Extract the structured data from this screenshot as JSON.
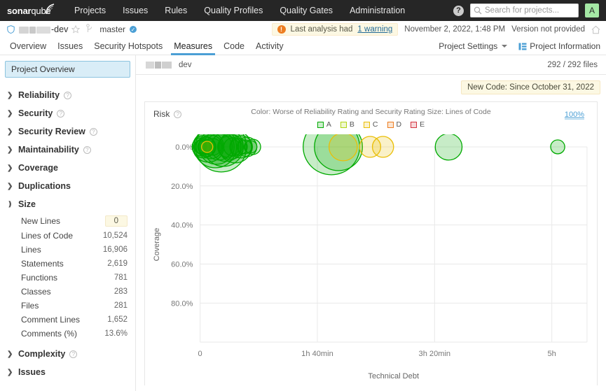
{
  "topnav": {
    "logo": {
      "bold": "sonar",
      "light": "qube",
      "icon": "sonarqube-logo"
    },
    "links": [
      {
        "label": "Projects",
        "name": "nav-projects"
      },
      {
        "label": "Issues",
        "name": "nav-issues"
      },
      {
        "label": "Rules",
        "name": "nav-rules"
      },
      {
        "label": "Quality Profiles",
        "name": "nav-quality-profiles"
      },
      {
        "label": "Quality Gates",
        "name": "nav-quality-gates"
      },
      {
        "label": "Administration",
        "name": "nav-administration"
      }
    ],
    "help_icon": "help-icon",
    "search": {
      "placeholder": "Search for projects...",
      "value": ""
    },
    "avatar_initial": "A",
    "avatar_color": "#a5e8a5",
    "background": "#262626"
  },
  "project_header": {
    "quality_gate_icon": "quality-gate-shield-icon",
    "project_name_suffix": "-dev",
    "project_name_redacted": true,
    "favorite_icon": "star-icon",
    "branch_icon": "branch-icon",
    "branch_name": "master",
    "branch_badge": "✓",
    "warning_prefix": "Last analysis had",
    "warning_link": "1 warning",
    "analysis_date": "November 2, 2022, 1:48 PM",
    "version": "Version not provided",
    "home_icon": "home-icon"
  },
  "tabs": {
    "items": [
      {
        "label": "Overview",
        "name": "tab-overview",
        "active": false
      },
      {
        "label": "Issues",
        "name": "tab-issues",
        "active": false
      },
      {
        "label": "Security Hotspots",
        "name": "tab-security-hotspots",
        "active": false
      },
      {
        "label": "Measures",
        "name": "tab-measures",
        "active": true
      },
      {
        "label": "Code",
        "name": "tab-code",
        "active": false
      },
      {
        "label": "Activity",
        "name": "tab-activity",
        "active": false
      }
    ],
    "project_settings": "Project Settings",
    "project_information": "Project Information",
    "active_color": "#4b9fd5"
  },
  "sidebar": {
    "overview_button": "Project Overview",
    "groups": [
      {
        "label": "Reliability",
        "name": "sidebar-group-reliability",
        "expanded": false,
        "help": true
      },
      {
        "label": "Security",
        "name": "sidebar-group-security",
        "expanded": false,
        "help": true
      },
      {
        "label": "Security Review",
        "name": "sidebar-group-security-review",
        "expanded": false,
        "help": true
      },
      {
        "label": "Maintainability",
        "name": "sidebar-group-maintainability",
        "expanded": false,
        "help": true
      },
      {
        "label": "Coverage",
        "name": "sidebar-group-coverage",
        "expanded": false,
        "help": false
      },
      {
        "label": "Duplications",
        "name": "sidebar-group-duplications",
        "expanded": false,
        "help": false
      },
      {
        "label": "Size",
        "name": "sidebar-group-size",
        "expanded": true,
        "help": false
      }
    ],
    "size_metrics": [
      {
        "label": "New Lines",
        "value": "0",
        "badge": true
      },
      {
        "label": "Lines of Code",
        "value": "10,524",
        "badge": false
      },
      {
        "label": "Lines",
        "value": "16,906",
        "badge": false
      },
      {
        "label": "Statements",
        "value": "2,619",
        "badge": false
      },
      {
        "label": "Functions",
        "value": "781",
        "badge": false
      },
      {
        "label": "Classes",
        "value": "283",
        "badge": false
      },
      {
        "label": "Files",
        "value": "281",
        "badge": false
      },
      {
        "label": "Comment Lines",
        "value": "1,652",
        "badge": false
      },
      {
        "label": "Comments (%)",
        "value": "13.6%",
        "badge": false
      }
    ],
    "bottom_groups": [
      {
        "label": "Complexity",
        "name": "sidebar-group-complexity",
        "help": true
      },
      {
        "label": "Issues",
        "name": "sidebar-group-issues",
        "help": false
      }
    ]
  },
  "main": {
    "breadcrumb_label": "dev",
    "breadcrumb_redacted": true,
    "files_count": "292 / 292 files",
    "new_code_badge": "New Code: Since October 31, 2022"
  },
  "chart_data": {
    "type": "scatter",
    "title": "Risk",
    "caption": "Color: Worse of Reliability Rating and Security Rating  Size: Lines of Code",
    "xlabel": "Technical Debt",
    "ylabel": "Coverage",
    "x_ticks": [
      "0",
      "1h 40min",
      "3h 20min",
      "5h"
    ],
    "x_tick_values": [
      0,
      100,
      200,
      300
    ],
    "xlim": [
      0,
      330
    ],
    "y_ticks": [
      "0.0%",
      "20.0%",
      "40.0%",
      "60.0%",
      "80.0%"
    ],
    "y_tick_values": [
      0,
      20,
      40,
      60,
      80
    ],
    "ylim": [
      0,
      100
    ],
    "y_inverted": true,
    "grid": true,
    "top_right_link": "100%",
    "legend_position": "top-center",
    "legend": [
      {
        "label": "A",
        "color": "#00aa00",
        "fill": "#00aa0033"
      },
      {
        "label": "B",
        "color": "#b0d513",
        "fill": "#b0d51333"
      },
      {
        "label": "C",
        "color": "#eabe06",
        "fill": "#eabe0633"
      },
      {
        "label": "D",
        "color": "#ed7d20",
        "fill": "#ed7d2033"
      },
      {
        "label": "E",
        "color": "#d4333f",
        "fill": "#d4333f33"
      }
    ],
    "bubbles": [
      {
        "x": 0,
        "y": 0,
        "r": 9,
        "rating": "A"
      },
      {
        "x": 1,
        "y": 0,
        "r": 13,
        "rating": "A"
      },
      {
        "x": 2,
        "y": 0,
        "r": 11,
        "rating": "A"
      },
      {
        "x": 3,
        "y": 0,
        "r": 16,
        "rating": "A"
      },
      {
        "x": 4,
        "y": 0,
        "r": 10,
        "rating": "A"
      },
      {
        "x": 5,
        "y": 0,
        "r": 14,
        "rating": "A"
      },
      {
        "x": 6,
        "y": 0,
        "r": 8,
        "rating": "C"
      },
      {
        "x": 7,
        "y": 0,
        "r": 22,
        "rating": "A"
      },
      {
        "x": 9,
        "y": 0,
        "r": 17,
        "rating": "A"
      },
      {
        "x": 11,
        "y": 0,
        "r": 12,
        "rating": "A"
      },
      {
        "x": 13,
        "y": 0,
        "r": 30,
        "rating": "A"
      },
      {
        "x": 14,
        "y": 0,
        "r": 25,
        "rating": "A"
      },
      {
        "x": 16,
        "y": 0,
        "r": 19,
        "rating": "A"
      },
      {
        "x": 18,
        "y": 0,
        "r": 36,
        "rating": "A"
      },
      {
        "x": 20,
        "y": 0,
        "r": 28,
        "rating": "A"
      },
      {
        "x": 22,
        "y": 0,
        "r": 21,
        "rating": "A"
      },
      {
        "x": 24,
        "y": 0,
        "r": 15,
        "rating": "A"
      },
      {
        "x": 26,
        "y": 0,
        "r": 18,
        "rating": "A"
      },
      {
        "x": 28,
        "y": 0,
        "r": 13,
        "rating": "A"
      },
      {
        "x": 30,
        "y": 0,
        "r": 23,
        "rating": "A"
      },
      {
        "x": 33,
        "y": 0,
        "r": 12,
        "rating": "A"
      },
      {
        "x": 35,
        "y": 0,
        "r": 16,
        "rating": "A"
      },
      {
        "x": 38,
        "y": 0,
        "r": 10,
        "rating": "A"
      },
      {
        "x": 40,
        "y": 0,
        "r": 14,
        "rating": "A"
      },
      {
        "x": 43,
        "y": 0,
        "r": 9,
        "rating": "A"
      },
      {
        "x": 45,
        "y": 0,
        "r": 11,
        "rating": "A"
      },
      {
        "x": 112,
        "y": 0,
        "r": 40,
        "rating": "A"
      },
      {
        "x": 118,
        "y": 0,
        "r": 34,
        "rating": "A"
      },
      {
        "x": 122,
        "y": 0,
        "r": 20,
        "rating": "C"
      },
      {
        "x": 145,
        "y": 0,
        "r": 15,
        "rating": "C"
      },
      {
        "x": 156,
        "y": 0,
        "r": 15,
        "rating": "C"
      },
      {
        "x": 212,
        "y": 0,
        "r": 19,
        "rating": "A"
      },
      {
        "x": 305,
        "y": 0,
        "r": 10,
        "rating": "A"
      }
    ]
  }
}
